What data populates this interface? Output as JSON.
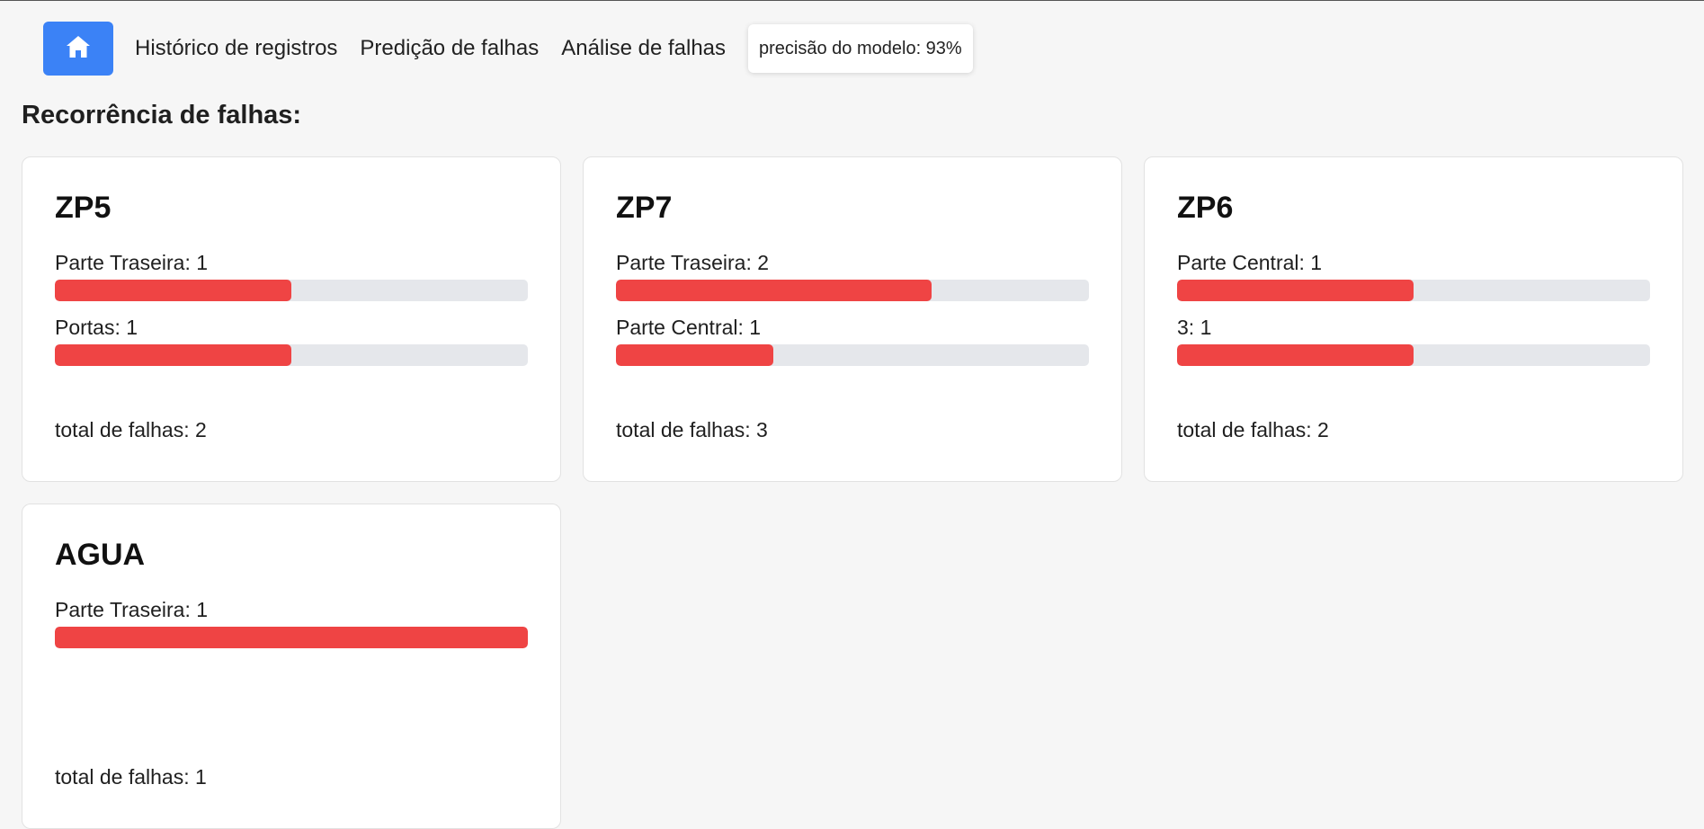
{
  "nav": {
    "home_icon": "home-icon",
    "links": [
      "Histórico de registros",
      "Predição de falhas",
      "Análise de falhas"
    ],
    "accuracy": "precisão do modelo: 93%"
  },
  "section_title": "Recorrência de falhas:",
  "colors": {
    "accent": "#3b82f6",
    "bar_fill": "#ef4444",
    "bar_track": "#e5e7eb"
  },
  "cards": [
    {
      "title": "ZP5",
      "rows": [
        {
          "label": "Parte Traseira: 1",
          "fraction": 0.5
        },
        {
          "label": "Portas: 1",
          "fraction": 0.5
        }
      ],
      "total": "total de falhas: 2"
    },
    {
      "title": "ZP7",
      "rows": [
        {
          "label": "Parte Traseira: 2",
          "fraction": 0.6667
        },
        {
          "label": "Parte Central: 1",
          "fraction": 0.3333
        }
      ],
      "total": "total de falhas: 3"
    },
    {
      "title": "ZP6",
      "rows": [
        {
          "label": "Parte Central: 1",
          "fraction": 0.5
        },
        {
          "label": "3: 1",
          "fraction": 0.5
        }
      ],
      "total": "total de falhas: 2"
    },
    {
      "title": "AGUA",
      "rows": [
        {
          "label": "Parte Traseira: 1",
          "fraction": 1.0
        }
      ],
      "total": "total de falhas: 1"
    }
  ]
}
